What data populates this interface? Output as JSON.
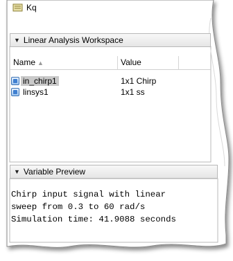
{
  "top_item": {
    "label": "Kq",
    "icon": "workspace-item-icon"
  },
  "workspace": {
    "title": "Linear Analysis Workspace",
    "columns": {
      "name": "Name",
      "value": "Value"
    },
    "rows": [
      {
        "name": "in_chirp1",
        "value": "1x1 Chirp",
        "selected": true,
        "icon": "variable-icon"
      },
      {
        "name": "linsys1",
        "value": "1x1 ss",
        "selected": false,
        "icon": "variable-icon"
      }
    ]
  },
  "preview": {
    "title": "Variable Preview",
    "lines": [
      "Chirp input signal with linear",
      "sweep from 0.3 to 60 rad/s",
      "Simulation time: 41.9088 seconds"
    ]
  },
  "colors": {
    "selection": "#c9c9c9",
    "header_bg": "#ececec",
    "border": "#b8b8b8",
    "icon_blue": "#3f7fd0"
  }
}
